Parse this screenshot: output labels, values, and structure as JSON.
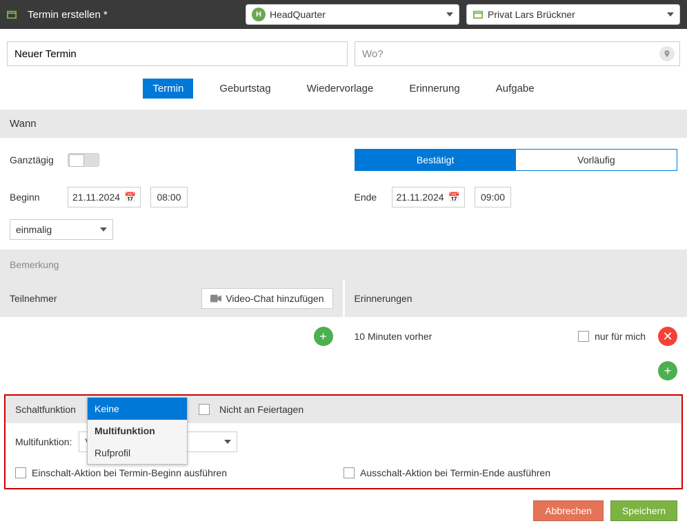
{
  "header": {
    "title": "Termin erstellen *",
    "org": "HeadQuarter",
    "org_badge": "H",
    "calendar": "Privat Lars Brückner"
  },
  "title_row": {
    "title_value": "Neuer Termin",
    "location_placeholder": "Wo?"
  },
  "type_tabs": [
    "Termin",
    "Geburtstag",
    "Wiedervorlage",
    "Erinnerung",
    "Aufgabe"
  ],
  "sections": {
    "wann": "Wann",
    "teilnehmer": "Teilnehmer",
    "erinnerungen": "Erinnerungen",
    "schaltfunktion": "Schaltfunktion"
  },
  "wann": {
    "allday_label": "Ganztägig",
    "status_confirmed": "Bestätigt",
    "status_tentative": "Vorläufig",
    "begin_label": "Beginn",
    "end_label": "Ende",
    "begin_date": "21.11.2024",
    "begin_time": "08:00",
    "end_date": "21.11.2024",
    "end_time": "09:00",
    "recurrence": "einmalig",
    "remark_placeholder": "Bemerkung"
  },
  "teilnehmer": {
    "video_btn": "Video-Chat hinzufügen"
  },
  "erinnerungen": {
    "item": "10 Minuten vorher",
    "only_me": "nur für mich"
  },
  "schalt": {
    "not_on_holidays": "Nicht an Feiertagen",
    "multifunktion_label": "Multifunktion:",
    "multifunktion_value_prefix": "V",
    "on_action": "Einschalt-Aktion bei Termin-Beginn ausführen",
    "off_action": "Ausschalt-Aktion bei Termin-Ende ausführen",
    "options": {
      "none": "Keine",
      "multi": "Multifunktion",
      "profile": "Rufprofil"
    }
  },
  "footer": {
    "cancel": "Abbrechen",
    "save": "Speichern"
  }
}
